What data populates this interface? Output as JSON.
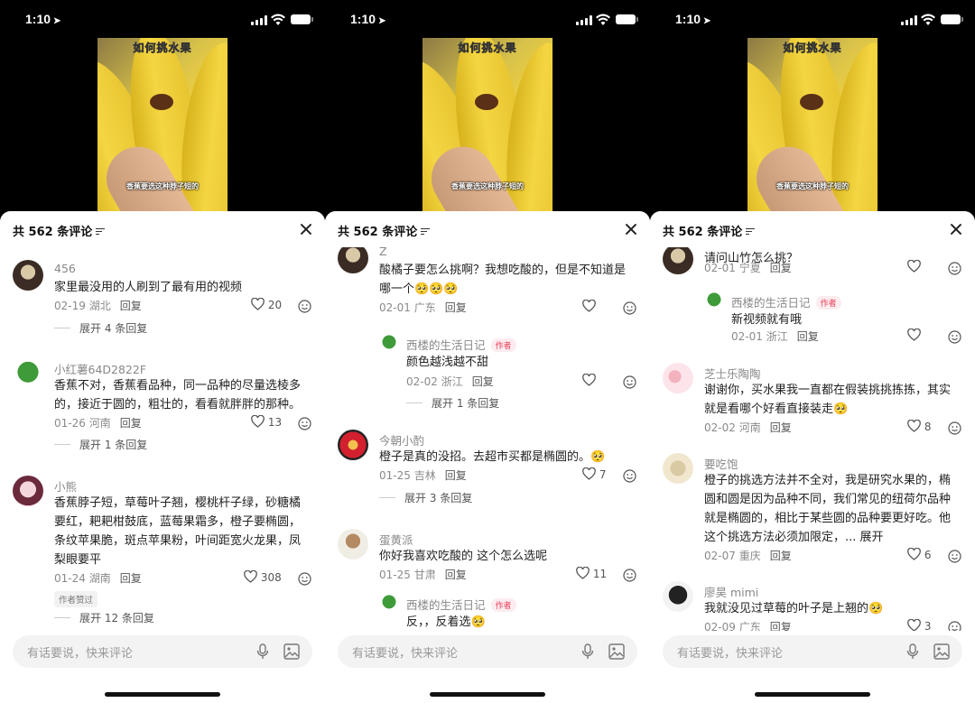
{
  "status": {
    "time": "1:10",
    "arrow": "➤"
  },
  "video": {
    "title": "如何挑水果",
    "caption": "香蕉要选这种脖子短的"
  },
  "header": {
    "title": "共 562 条评论"
  },
  "input": {
    "placeholder": "有话要说，快来评论"
  },
  "panels": [
    {
      "comments": [
        {
          "user": "456",
          "text": [
            "家里最没用的人刷到了最有用的视频"
          ],
          "date": "02-19",
          "region": "湖北",
          "reply": "回复",
          "likes": "20",
          "expand": "展开 4 条回复"
        },
        {
          "user": "小红薯64D2822F",
          "text": [
            "香蕉不对，香蕉看品种，同一品种的尽量选棱多",
            "的，接近于圆的，粗壮的，看看就胖胖的那种。"
          ],
          "date": "01-26",
          "region": "河南",
          "reply": "回复",
          "likes": "13",
          "expand": "展开 1 条回复"
        },
        {
          "user": "小熊",
          "text": [
            "香蕉脖子短，草莓叶子翘，樱桃杆子绿，砂糖橘",
            "要红，耙耙柑鼓底，蓝莓果霜多，橙子要椭圆，",
            "条纹苹果脆，斑点苹果粉，叶间距宽火龙果，凤",
            "梨眼要平"
          ],
          "date": "01-24",
          "region": "湖南",
          "reply": "回复",
          "likes": "308",
          "badge": "作者赞过",
          "expand": "展开 12 条回复"
        }
      ]
    },
    {
      "comments": [
        {
          "user": "Z",
          "text": [
            "酸橘子要怎么挑啊？我想吃酸的，但是不知道是",
            "哪一个🥺🥺🥺"
          ],
          "date": "02-01",
          "region": "广东",
          "reply": "回复",
          "likes": ""
        },
        {
          "user": "西楼的生活日记",
          "tag": "作者",
          "text": [
            "颜色越浅越不甜"
          ],
          "date": "02-02",
          "region": "浙江",
          "reply": "回复",
          "likes": "",
          "expand": "展开 1 条回复"
        },
        {
          "user": "今朝小酌",
          "text": [
            "橙子是真的没招。去超市买都是椭圆的。🥺"
          ],
          "date": "01-25",
          "region": "吉林",
          "reply": "回复",
          "likes": "7",
          "expand": "展开 3 条回复"
        },
        {
          "user": "蛋黄派",
          "text": [
            "你好我喜欢吃酸的 这个怎么选呢"
          ],
          "date": "01-25",
          "region": "甘肃",
          "reply": "回复",
          "likes": "11"
        },
        {
          "user": "西楼的生活日记",
          "tag": "作者",
          "text": [
            "反，，反着选🥺"
          ]
        }
      ]
    },
    {
      "comments": [
        {
          "user": "",
          "text": [
            "请问山竹怎么挑？"
          ],
          "date": "02-01",
          "region": "宁夏",
          "reply": "回复",
          "likes": ""
        },
        {
          "user": "西楼的生活日记",
          "tag": "作者",
          "text": [
            "新视频就有哦"
          ],
          "date": "02-01",
          "region": "浙江",
          "reply": "回复",
          "likes": ""
        },
        {
          "user": "芝士乐陶陶",
          "text": [
            "谢谢你，买水果我一直都在假装挑挑拣拣，其实",
            "就是看哪个好看直接装走🥺"
          ],
          "date": "02-02",
          "region": "河南",
          "reply": "回复",
          "likes": "8"
        },
        {
          "user": "要吃饱",
          "text": [
            "橙子的挑选方法并不全对，我是研究水果的，椭",
            "圆和圆是因为品种不同，我们常见的纽荷尔品种",
            "就是椭圆的，相比于某些圆的品种要更好吃。他",
            "这个挑选方法必须加限定，... 展开"
          ],
          "date": "02-07",
          "region": "重庆",
          "reply": "回复",
          "likes": "6"
        },
        {
          "user": "廖昊 mimi",
          "text": [
            "我就没见过草莓的叶子是上翘的🥺"
          ],
          "date": "02-09",
          "region": "广东",
          "reply": "回复",
          "likes": "3"
        }
      ]
    }
  ]
}
